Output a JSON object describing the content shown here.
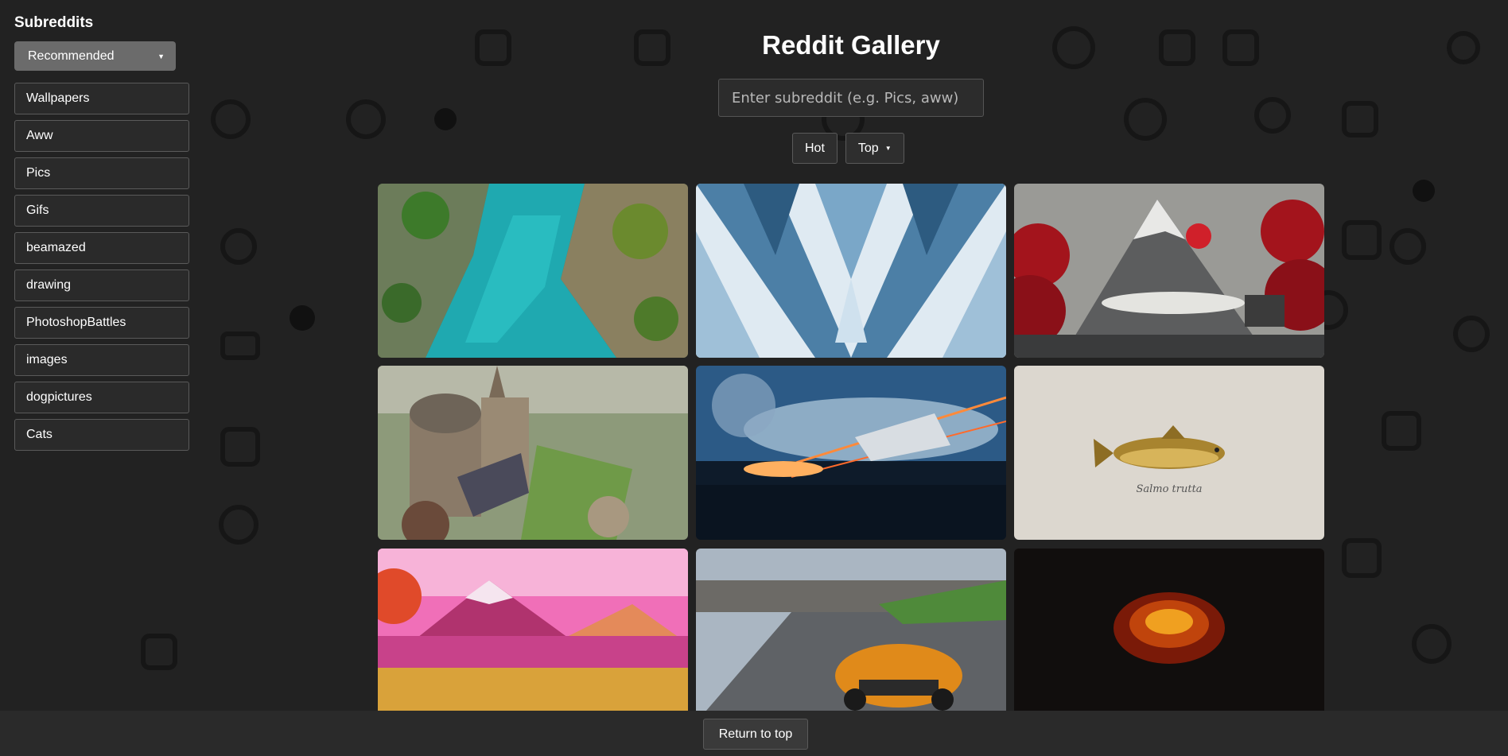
{
  "sidebar": {
    "title": "Subreddits",
    "dropdown_label": "Recommended",
    "items": [
      {
        "label": "Wallpapers"
      },
      {
        "label": "Aww"
      },
      {
        "label": "Pics"
      },
      {
        "label": "Gifs"
      },
      {
        "label": "beamazed"
      },
      {
        "label": "drawing"
      },
      {
        "label": "PhotoshopBattles"
      },
      {
        "label": "images"
      },
      {
        "label": "dogpictures"
      },
      {
        "label": "Cats"
      }
    ]
  },
  "header": {
    "title": "Reddit Gallery"
  },
  "search": {
    "placeholder": "Enter subreddit (e.g. Pics, aww)"
  },
  "sort": {
    "hot_label": "Hot",
    "top_label": "Top",
    "top_caret": "▼"
  },
  "gallery": {
    "images": [
      {
        "subject": "turquoise river canyon"
      },
      {
        "subject": "blue crystal geometric"
      },
      {
        "subject": "mountain with red sun and red trees"
      },
      {
        "subject": "fantasy castle city"
      },
      {
        "subject": "x-wing space battle"
      },
      {
        "subject": "trout illustration",
        "caption": "Salmo trutta"
      },
      {
        "subject": "pink mountain landscape"
      },
      {
        "subject": "orange sports car on race track"
      },
      {
        "subject": "fire on dark background"
      }
    ]
  },
  "footer": {
    "return_label": "Return to top"
  },
  "colors": {
    "background": "#222222",
    "dropdown": "#6b6b6b",
    "accent_red": "#d0202a"
  }
}
